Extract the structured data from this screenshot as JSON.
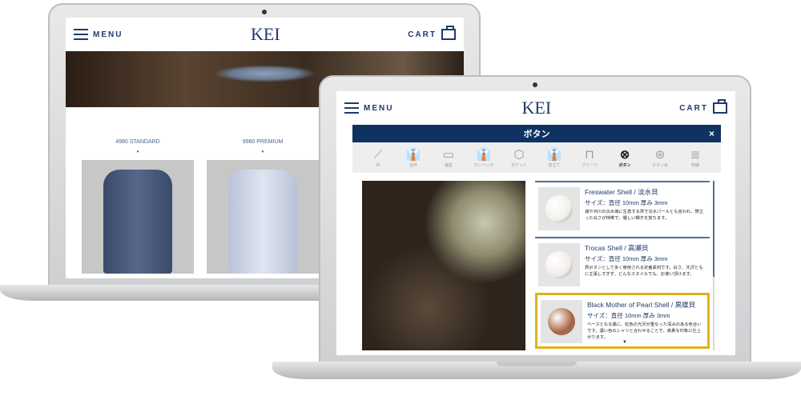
{
  "back_screen": {
    "header": {
      "menu_label": "MENU",
      "logo": "KEI",
      "cart_label": "CART"
    },
    "plans": [
      {
        "label": "4980 STANDARD"
      },
      {
        "label": "9980 PREMIUM"
      }
    ]
  },
  "front_screen": {
    "header": {
      "menu_label": "MENU",
      "logo": "KEI",
      "cart_label": "CART"
    },
    "modal": {
      "title": "ボタン",
      "close": "×",
      "options": [
        {
          "label": "衿",
          "icon": "collar-icon",
          "glyph": "⟋"
        },
        {
          "label": "台衿",
          "icon": "shirt-icon",
          "glyph": "👔"
        },
        {
          "label": "袖型",
          "icon": "cuff-icon",
          "glyph": "▭"
        },
        {
          "label": "クレリック",
          "icon": "cleric-shirt-icon",
          "glyph": "👔"
        },
        {
          "label": "ポケット",
          "icon": "pocket-icon",
          "glyph": "⬡"
        },
        {
          "label": "前立て",
          "icon": "placket-icon",
          "glyph": "👔"
        },
        {
          "label": "プリーツ",
          "icon": "pleats-icon",
          "glyph": "⊓"
        },
        {
          "label": "ボタン",
          "icon": "button-icon",
          "glyph": "⊗",
          "selected": true
        },
        {
          "label": "ボタン糸",
          "icon": "button-thread-icon",
          "glyph": "⊛"
        },
        {
          "label": "刺繍",
          "icon": "embroidery-icon",
          "glyph": "≣"
        }
      ],
      "items": [
        {
          "name": "Freswater Shell / 淡水貝",
          "size": "サイズ：直径 10mm 厚み 3mm",
          "desc": "湖や河川の淡水域に生息する貝で淡水パールとも言われ、際立った白さが特徴で、優しい輝きを放ちます。",
          "color": "#f2f0ea"
        },
        {
          "name": "Trocas Shell / 高瀬貝",
          "size": "サイズ：直径 10mm 厚み 3mm",
          "desc": "貝ボタンとして多く使用される定番素材です。白さ、光沢ともに主張しすぎず、どんなスタイルでも、お使い頂けます。",
          "color": "#f4ecea"
        },
        {
          "name": "Black Mother of Pearl Shell / 黒蝶貝",
          "size": "サイズ：直径 10mm 厚み 3mm",
          "desc": "ベースとなる黒に、虹色の光沢が重なった深みのある色合いです。濃い色のシャツと合わせることで、高貴な印象に仕上がります。",
          "color": "#a8623f",
          "selected": true
        }
      ]
    }
  },
  "colors": {
    "navy": "#0f3263",
    "highlight": "#e0b21a"
  }
}
